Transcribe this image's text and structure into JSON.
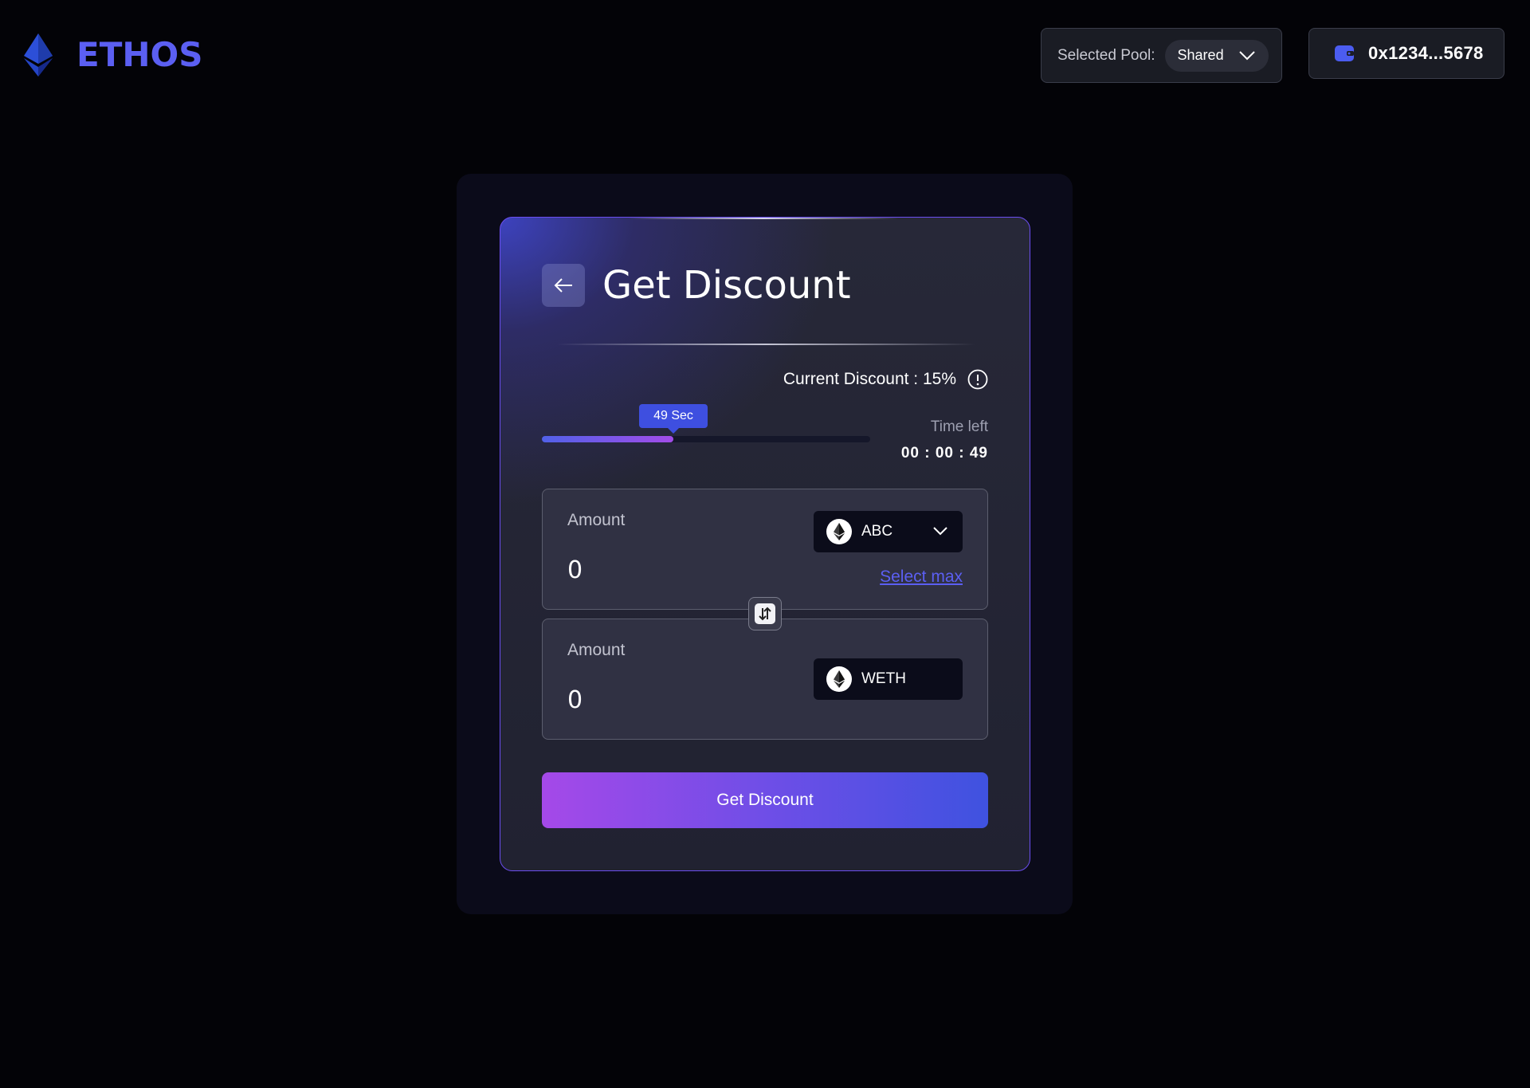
{
  "brand": {
    "name": "ETHOS",
    "logo_icon": "ethereum-diamond-icon",
    "accent": "#5b5ff2"
  },
  "header": {
    "pool_label": "Selected Pool:",
    "pool_value": "Shared",
    "wallet_address": "0x1234...5678",
    "wallet_icon": "wallet-icon"
  },
  "card": {
    "title": "Get Discount",
    "back_icon": "arrow-left-icon",
    "current_discount": "Current Discount : 15%",
    "info_icon": "info-icon",
    "progress": {
      "tooltip": "49 Sec",
      "fraction": 0.4
    },
    "time_left_label": "Time left",
    "time_left_value": "00 : 00 : 49",
    "from": {
      "label": "Amount",
      "value": "0",
      "token": "ABC",
      "token_icon": "ethereum-token-icon",
      "select_max": "Select max"
    },
    "to": {
      "label": "Amount",
      "value": "0",
      "token": "WETH",
      "token_icon": "ethereum-token-icon"
    },
    "swap_icon": "swap-arrows-icon",
    "cta_label": "Get Discount"
  }
}
